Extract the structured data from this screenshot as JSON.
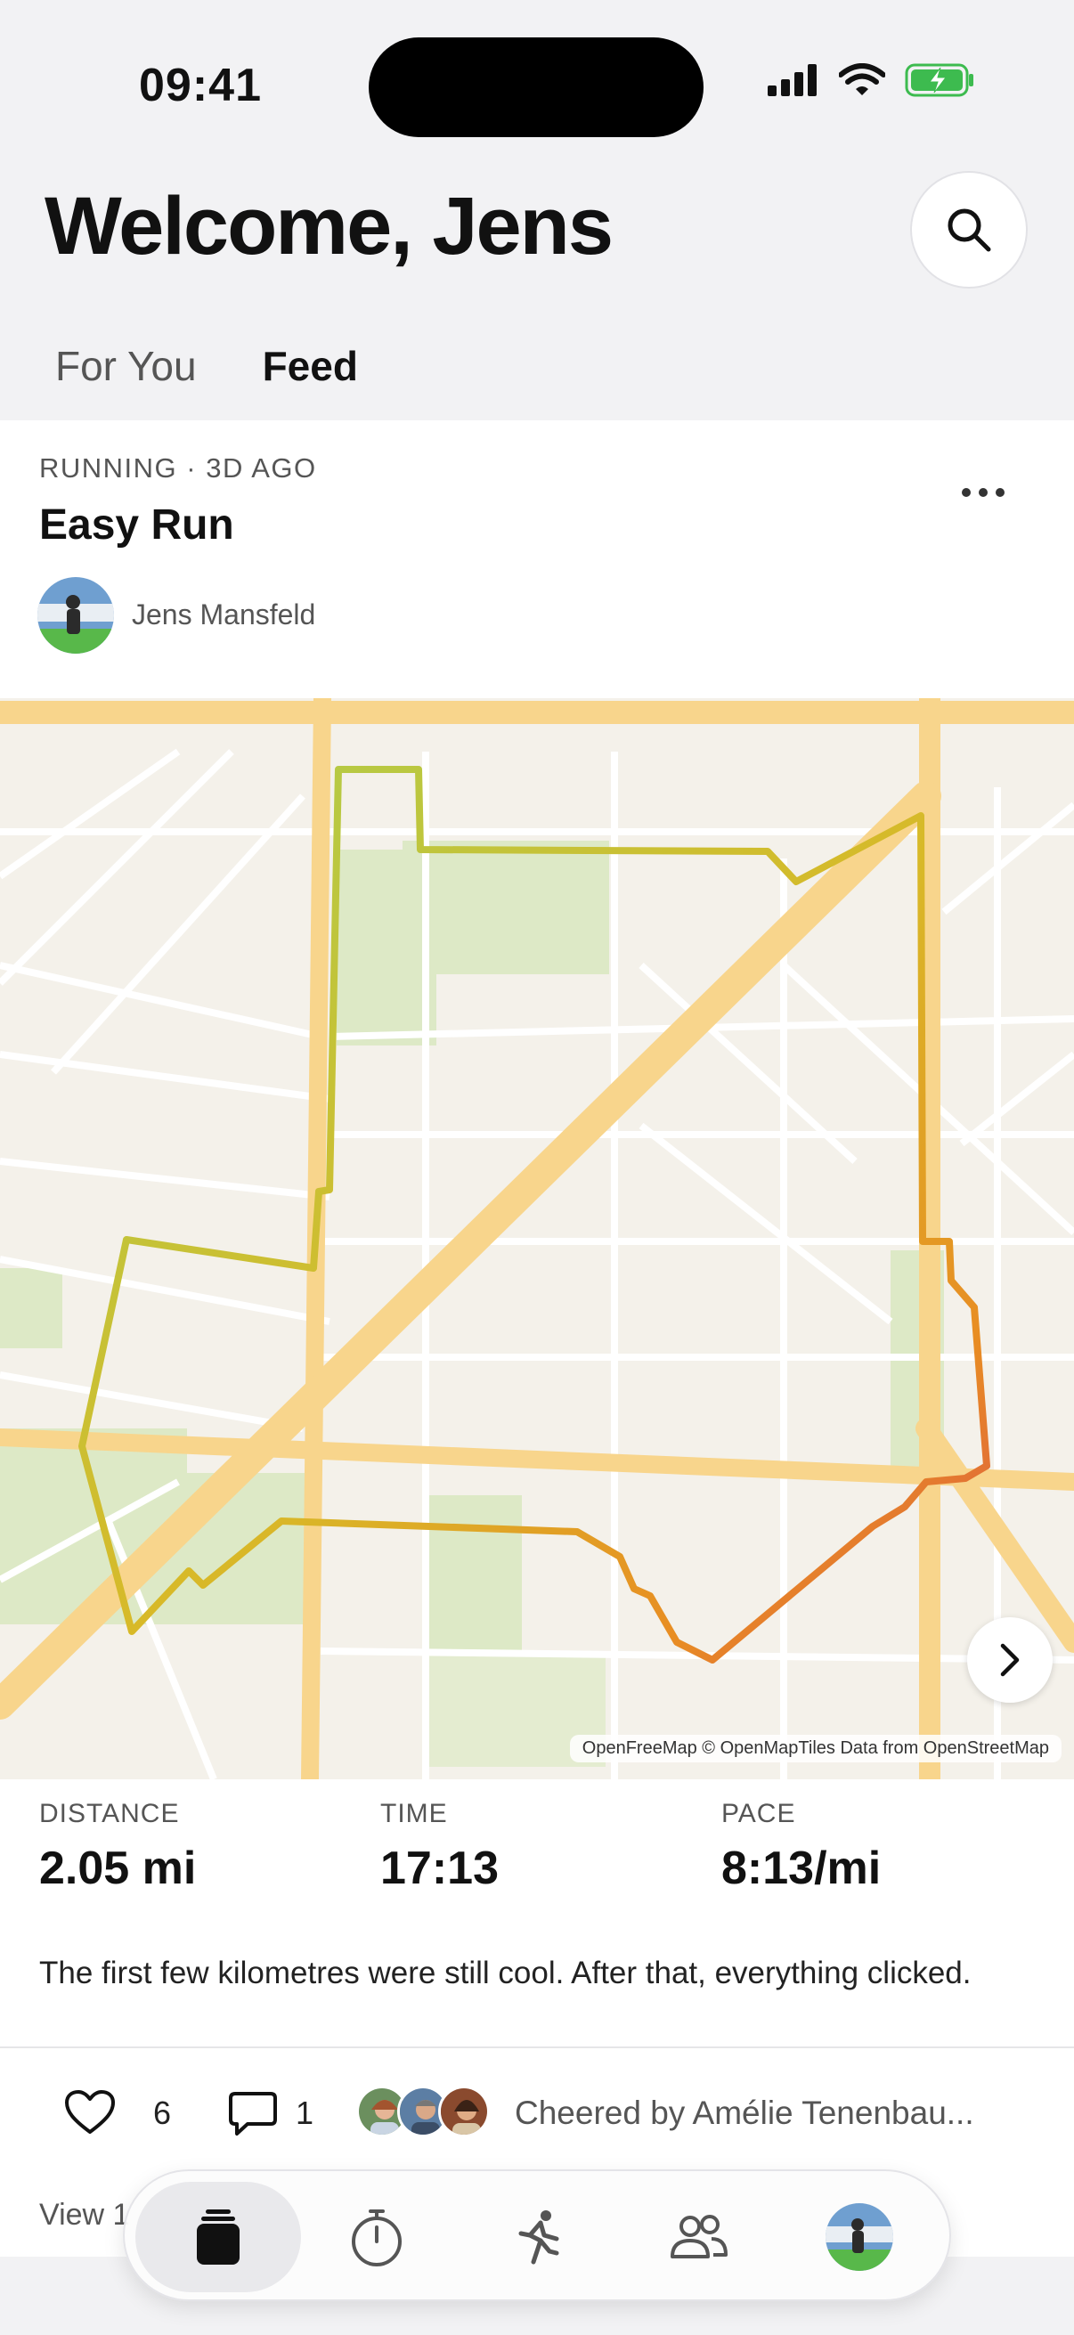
{
  "status_bar": {
    "time": "09:41"
  },
  "header": {
    "title": "Welcome, Jens"
  },
  "tabs": [
    {
      "label": "For You",
      "active": false
    },
    {
      "label": "Feed",
      "active": true
    }
  ],
  "activity": {
    "meta": "RUNNING · 3D AGO",
    "title": "Easy Run",
    "author": "Jens Mansfeld",
    "map_attribution": "OpenFreeMap © OpenMapTiles Data from OpenStreetMap",
    "stats": [
      {
        "label": "DISTANCE",
        "value": "2.05 mi"
      },
      {
        "label": "TIME",
        "value": "17:13"
      },
      {
        "label": "PACE",
        "value": "8:13/mi"
      }
    ],
    "description": "The first few kilometres were still cool. After that, everything clicked.",
    "likes": "6",
    "comments": "1",
    "cheered_by": "Cheered by Amélie Tenenbau...",
    "view_link": "View 1"
  },
  "colors": {
    "route_start": "#a3d353",
    "route_mid": "#e8a323",
    "route_end": "#d42a62",
    "road_major": "#f8d58c",
    "park": "#dde9c6"
  },
  "nav": {
    "items": [
      "feed-icon",
      "timer-icon",
      "run-icon",
      "friends-icon",
      "profile-avatar"
    ]
  }
}
